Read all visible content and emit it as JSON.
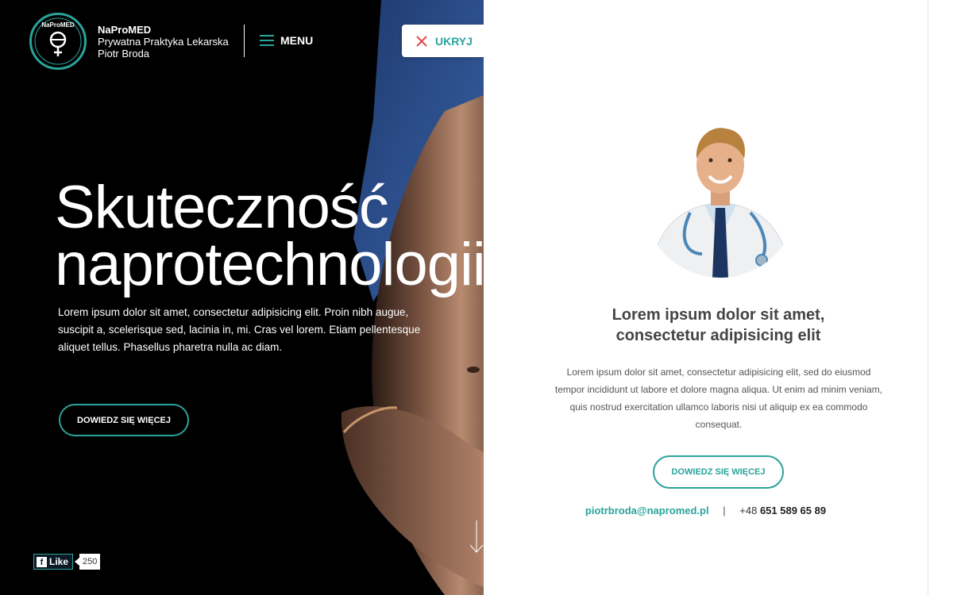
{
  "brand": {
    "logo_text": "NaProMED",
    "name": "NaProMED",
    "subtitle": "Prywatna Praktyka Lekarska",
    "owner": "Piotr Broda"
  },
  "nav": {
    "menu_label": "MENU",
    "hide_label": "UKRYJ"
  },
  "hero": {
    "title_line1": "Skuteczność",
    "title_line2": "naprotechnologii",
    "text": "Lorem ipsum dolor sit amet, consectetur adipisicing elit. Proin nibh augue, suscipit a, scelerisque sed, lacinia in, mi. Cras vel lorem. Etiam pellentesque aliquet tellus. Phasellus pharetra nulla ac diam.",
    "button_label": "DOWIEDZ SIĘ WIĘCEJ"
  },
  "social": {
    "fb_label": "Like",
    "fb_count": "250"
  },
  "panel": {
    "heading_line1": "Lorem ipsum dolor sit amet,",
    "heading_line2": "consectetur adipisicing elit",
    "text": "Lorem ipsum dolor sit amet, consectetur adipisicing elit, sed do eiusmod tempor incididunt ut labore et dolore magna aliqua. Ut enim ad minim veniam, quis nostrud exercitation ullamco laboris nisi ut aliquip ex ea commodo consequat.",
    "button_label": "DOWIEDZ SIĘ WIĘCEJ",
    "email": "piotrbroda@napromed.pl",
    "separator": "|",
    "phone_prefix": "+48",
    "phone_number": "651 589 65 89"
  },
  "icons": {
    "menu": "hamburger-icon",
    "hide": "close-icon",
    "scroll": "arrow-down-icon",
    "facebook": "facebook-icon"
  },
  "colors": {
    "accent": "#2aa39b",
    "hero_bg": "#000000",
    "panel_bg": "#ffffff"
  }
}
